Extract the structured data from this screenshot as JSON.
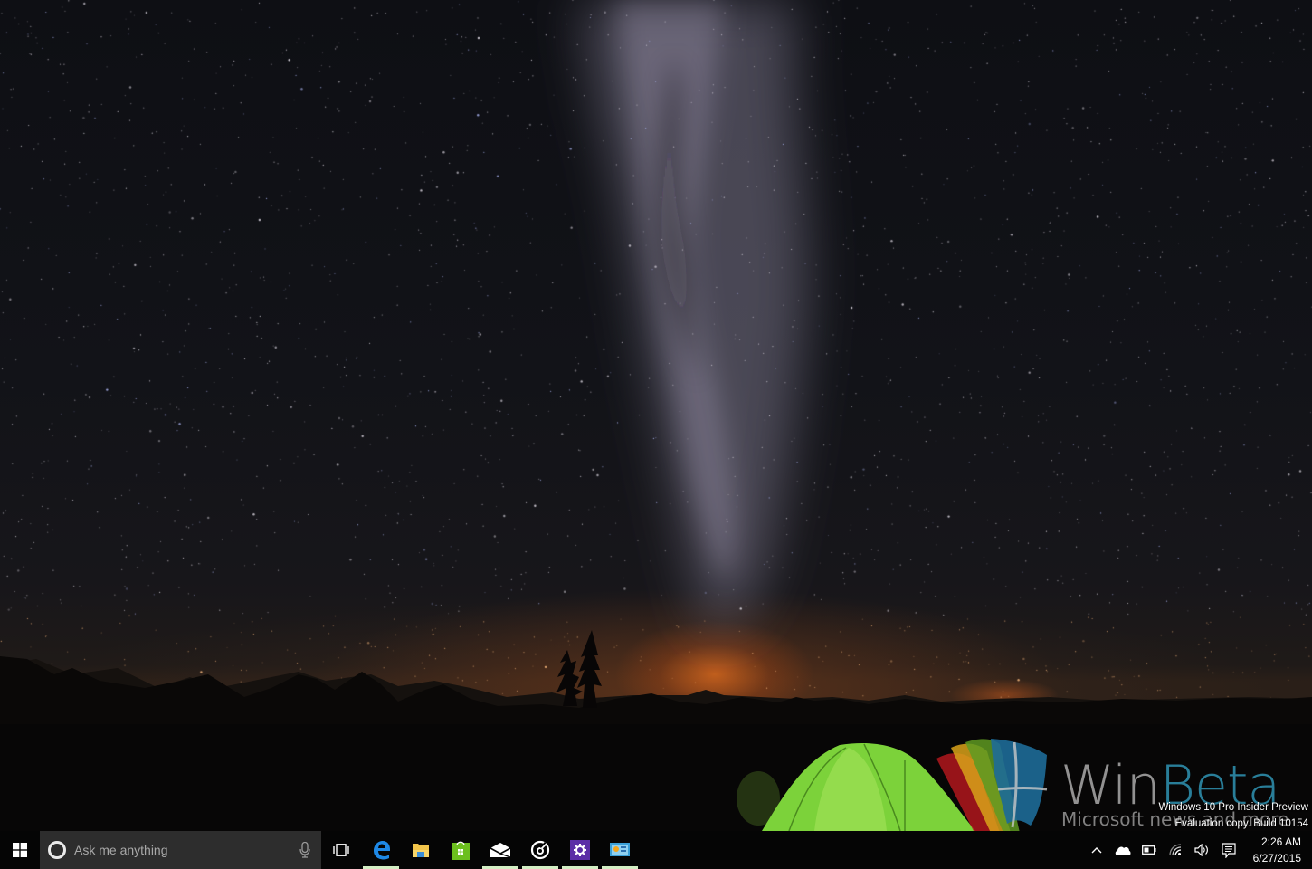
{
  "desktop": {
    "wallpaper": "night sky with milky way, mountains, green tent",
    "colors": {
      "sky": "#0e0f14",
      "horizon_glow": "#e06e1e",
      "tent": "#7cd23a",
      "mountains": "#0a0808"
    }
  },
  "watermark": {
    "brand_win": "Win",
    "brand_beta": "Beta",
    "tagline": "Microsoft news and more",
    "colors": {
      "win": "#aaaaaa",
      "beta": "#2d8caa",
      "red": "#b0171d",
      "yellow": "#d8a21a",
      "green": "#5e9a22",
      "blue": "#1e6b98"
    }
  },
  "evaluation": {
    "line1": "Windows 10 Pro Insider Preview",
    "line2": "Evaluation copy. Build 10154"
  },
  "taskbar": {
    "start_icon": "windows-logo-icon",
    "search": {
      "placeholder": "Ask me anything",
      "icon": "cortana-icon",
      "mic_icon": "microphone-icon"
    },
    "task_view_icon": "task-view-icon",
    "apps": [
      {
        "name": "Microsoft Edge",
        "icon": "edge-icon",
        "running": true,
        "color": "#1e88e5"
      },
      {
        "name": "File Explorer",
        "icon": "file-explorer-icon",
        "running": false,
        "color": "#f3c54b"
      },
      {
        "name": "Store",
        "icon": "store-icon",
        "running": false,
        "color": "#6cbf1e"
      },
      {
        "name": "Mail",
        "icon": "mail-icon",
        "running": true,
        "color": "#ffffff"
      },
      {
        "name": "Groove Music",
        "icon": "groove-music-icon",
        "running": true,
        "color": "#ffffff"
      },
      {
        "name": "Settings",
        "icon": "settings-icon",
        "running": true,
        "color": "#5b2ea6"
      },
      {
        "name": "Control Panel",
        "icon": "control-panel-icon",
        "running": true,
        "color": "#3aa0d8"
      }
    ],
    "running_indicator_color": "#d4eec4",
    "tray": {
      "icons": [
        "chevron-up-icon",
        "onedrive-icon",
        "battery-icon",
        "wifi-icon",
        "volume-icon",
        "action-center-icon"
      ],
      "time": "2:26 AM",
      "date": "6/27/2015"
    }
  }
}
